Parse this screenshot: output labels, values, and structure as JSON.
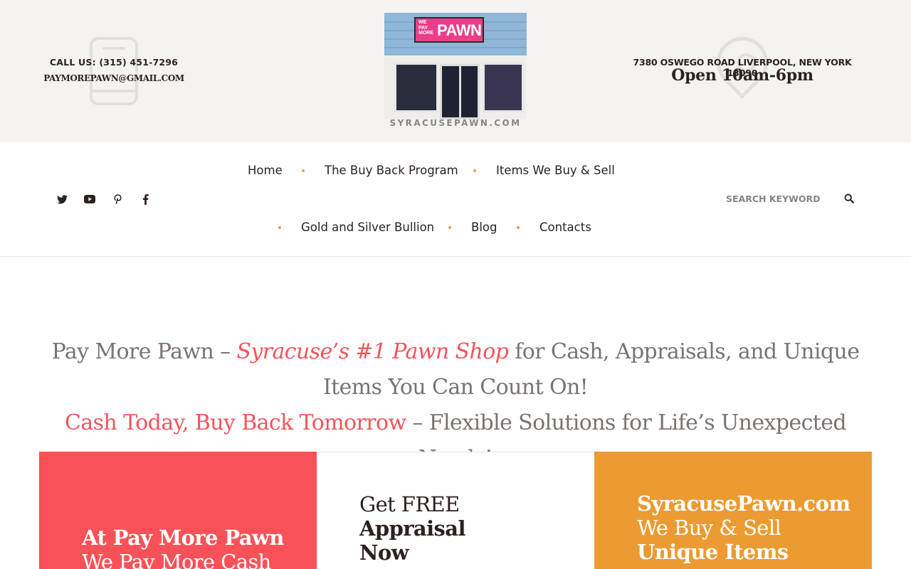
{
  "header": {
    "call_us": "CALL US: (315) 451-7296",
    "email": "PAYMOREPAWN@GMAIL.COM",
    "logo_sign_small": [
      "WE",
      "PAY",
      "MORE"
    ],
    "logo_sign_big": "PAWN",
    "site_caption": "SYRACUSEPAWN.COM",
    "address": "7380 OSWEGO ROAD LIVERPOOL, NEW YORK 13090",
    "hours": "Open 10am-6pm"
  },
  "social": {
    "icons": [
      "twitter-icon",
      "youtube-icon",
      "pinterest-icon",
      "facebook-icon"
    ],
    "color": "#2b2220"
  },
  "nav": {
    "items": [
      {
        "label": "Home",
        "active": true
      },
      {
        "label": "The Buy Back Program",
        "active": false
      },
      {
        "label": "Items We Buy & Sell",
        "active": false
      },
      {
        "label": "Gold and Silver Bullion",
        "active": false
      },
      {
        "label": "Blog",
        "active": false
      },
      {
        "label": "Contacts",
        "active": false
      }
    ],
    "active_color": "#f2545b",
    "separator_color": "#e8a33a"
  },
  "search": {
    "placeholder": "SEARCH KEYWORD",
    "icon": "search-icon"
  },
  "hero": {
    "line1_prefix": "Pay More Pawn – ",
    "line1_highlight": "Syracuse’s #1 Pawn Shop",
    "line1_suffix": " for Cash, Appraisals, and Unique Items You Can Count On!",
    "line2_highlight": "Cash Today, Buy Back Tomorrow",
    "line2_suffix": " – Flexible Solutions for Life’s Unexpected Needs!"
  },
  "cards": [
    {
      "line1": "At Pay More Pawn",
      "line2": "We Pay More Cash",
      "color": "#f95158"
    },
    {
      "line1": "Get FREE",
      "line2": "Appraisal",
      "line3": "Now",
      "color": "#ffffff"
    },
    {
      "line1": "SyracusePawn.com",
      "line2": "We Buy & Sell",
      "line3": "Unique Items",
      "color": "#eb9b31"
    }
  ]
}
